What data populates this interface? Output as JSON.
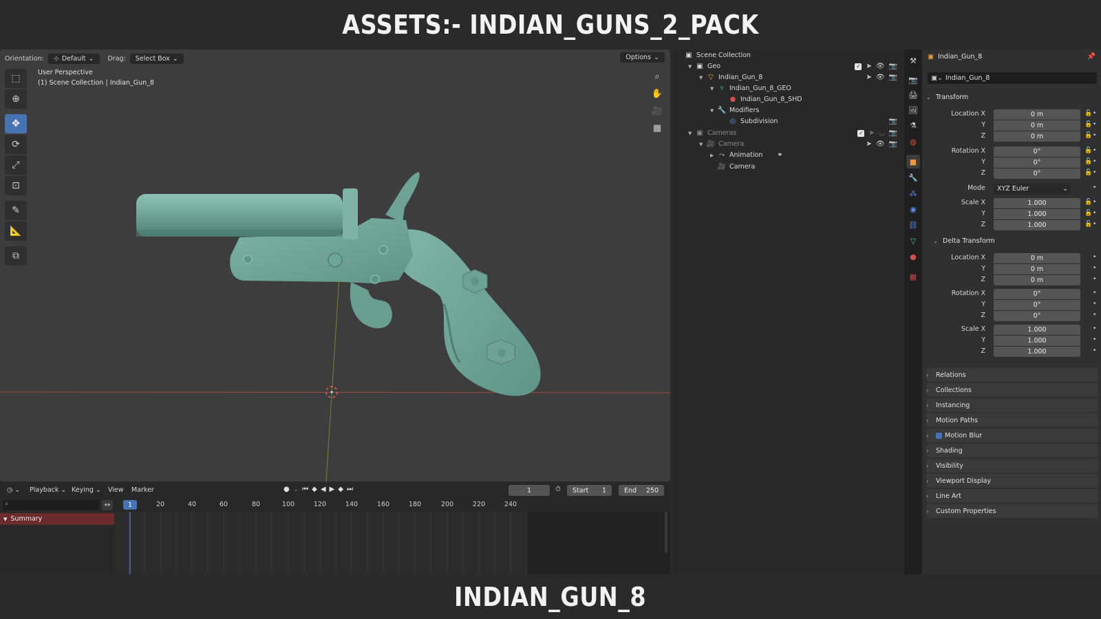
{
  "banner": {
    "top": "ASSETS:- INDIAN_GUNS_2_PACK",
    "bottom": "INDIAN_GUN_8"
  },
  "viewport": {
    "orientation_label": "Orientation:",
    "orientation_value": "Default",
    "drag_label": "Drag:",
    "drag_value": "Select Box",
    "options_label": "Options",
    "info_line1": "User Perspective",
    "info_line2": "(1) Scene Collection | Indian_Gun_8"
  },
  "outliner": {
    "scene_collection": "Scene Collection",
    "geo": "Geo",
    "object": "Indian_Gun_8",
    "mesh": "Indian_Gun_8_GEO",
    "material": "Indian_Gun_8_SHD",
    "modifiers": "Modifiers",
    "subdivision": "Subdivision",
    "cameras": "Cameras",
    "camera_obj": "Camera",
    "animation": "Animation",
    "camera_data": "Camera"
  },
  "properties": {
    "object_name": "Indian_Gun_8",
    "field_name": "Indian_Gun_8",
    "transform": "Transform",
    "location_x_label": "Location X",
    "rotation_x_label": "Rotation X",
    "scale_x_label": "Scale X",
    "y_label": "Y",
    "z_label": "Z",
    "mode_label": "Mode",
    "mode_value": "XYZ Euler",
    "loc": [
      "0 m",
      "0 m",
      "0 m"
    ],
    "rot": [
      "0°",
      "0°",
      "0°"
    ],
    "scale": [
      "1.000",
      "1.000",
      "1.000"
    ],
    "delta_transform": "Delta Transform",
    "delta_loc": [
      "0 m",
      "0 m",
      "0 m"
    ],
    "delta_rot": [
      "0°",
      "0°",
      "0°"
    ],
    "delta_scale": [
      "1.000",
      "1.000",
      "1.000"
    ],
    "panels": [
      "Relations",
      "Collections",
      "Instancing",
      "Motion Paths",
      "Motion Blur",
      "Shading",
      "Visibility",
      "Viewport Display",
      "Line Art",
      "Custom Properties"
    ]
  },
  "timeline": {
    "playback": "Playback",
    "keying": "Keying",
    "view": "View",
    "marker": "Marker",
    "current_frame": "1",
    "start_label": "Start",
    "start_value": "1",
    "end_label": "End",
    "end_value": "250",
    "summary": "Summary",
    "ruler_current": "1",
    "ticks": [
      "20",
      "40",
      "60",
      "80",
      "100",
      "120",
      "140",
      "160",
      "180",
      "200",
      "220",
      "240"
    ]
  },
  "colors": {
    "accent": "#4772b3",
    "gun": "#6fa597",
    "summary": "#6b2b2d"
  }
}
